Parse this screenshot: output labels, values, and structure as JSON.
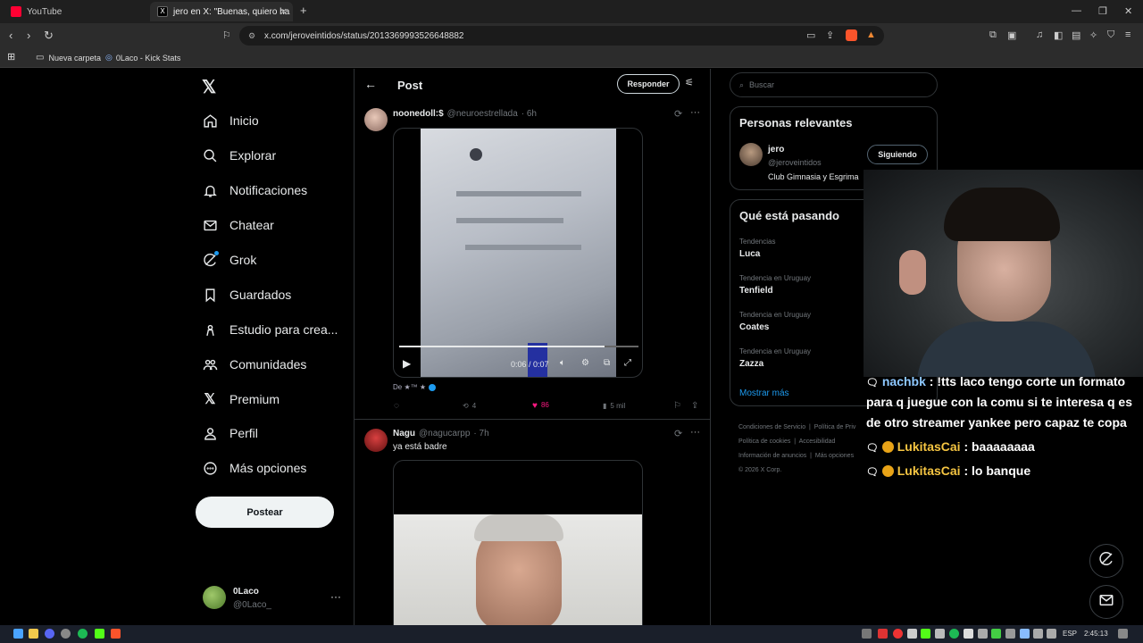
{
  "browser": {
    "tabs": [
      {
        "label": "YouTube",
        "active": false
      },
      {
        "label": "jero en X: \"Buenas, quiero ha",
        "active": true
      }
    ],
    "new_tab": "+",
    "url": "x.com/jeroveintidos/status/2013369993526648882",
    "bookmarks": [
      "Nueva carpeta",
      "0Laco - Kick Stats"
    ]
  },
  "sidebar": {
    "items": [
      {
        "label": "Inicio",
        "icon": "home-icon"
      },
      {
        "label": "Explorar",
        "icon": "search-icon"
      },
      {
        "label": "Notificaciones",
        "icon": "bell-icon"
      },
      {
        "label": "Chatear",
        "icon": "mail-icon"
      },
      {
        "label": "Grok",
        "icon": "grok-icon"
      },
      {
        "label": "Guardados",
        "icon": "bookmark-icon"
      },
      {
        "label": "Estudio para crea...",
        "icon": "studio-icon"
      },
      {
        "label": "Comunidades",
        "icon": "communities-icon"
      },
      {
        "label": "Premium",
        "icon": "x-logo-icon"
      },
      {
        "label": "Perfil",
        "icon": "person-icon"
      },
      {
        "label": "Más opciones",
        "icon": "more-circle-icon"
      }
    ],
    "post_button": "Postear",
    "account": {
      "name": "0Laco",
      "handle": "@0Laco_"
    }
  },
  "main": {
    "header_title": "Post",
    "reply_button": "Responder",
    "tweet1": {
      "name": "noonedoll:$",
      "handle": "@neuroestrellada",
      "time": "· 6h",
      "video_time": "0:06 / 0:07",
      "source": "De ★™ ★",
      "retweets": "4",
      "likes": "86",
      "views": "5 mil"
    },
    "tweet2": {
      "name": "Nagu",
      "handle": "@nagucarpp",
      "time": "· 7h",
      "text": "ya está badre"
    }
  },
  "right": {
    "search_placeholder": "Buscar",
    "relevant_title": "Personas relevantes",
    "person": {
      "name": "jero",
      "handle": "@jeroveintidos",
      "bio": "Club Gimnasia y Esgrima",
      "follow_label": "Siguiendo"
    },
    "trends_title": "Qué está pasando",
    "trends": [
      {
        "context": "Tendencias",
        "name": "Luca"
      },
      {
        "context": "Tendencia en Uruguay",
        "name": "Tenfield"
      },
      {
        "context": "Tendencia en Uruguay",
        "name": "Coates"
      },
      {
        "context": "Tendencia en Uruguay",
        "name": "Zazza"
      }
    ],
    "show_more": "Mostrar más",
    "footer": [
      "Condiciones de Servicio",
      "Política de Priv",
      "Política de cookies",
      "Accesibilidad",
      "Información de anuncios",
      "Más opciones",
      "© 2026 X Corp."
    ]
  },
  "chat": {
    "messages": [
      {
        "user": "nachbk",
        "text": " : !tts laco tengo corte un formato",
        "cont1": "para q juegue con la comu si te interesa q es",
        "cont2": "de otro streamer yankee pero capaz te copa",
        "user_color": "#8ec8ff"
      },
      {
        "user": "LukitasCai",
        "text": " : baaaaaaaa",
        "user_color": "#f5c542"
      },
      {
        "user": "LukitasCai",
        "text": " : lo banque",
        "user_color": "#f5c542"
      }
    ]
  },
  "taskbar": {
    "lang": "ESP",
    "time": "2:45:13"
  },
  "colors": {
    "accent": "#1d9bf0",
    "like": "#f91880",
    "bg": "#000000"
  }
}
